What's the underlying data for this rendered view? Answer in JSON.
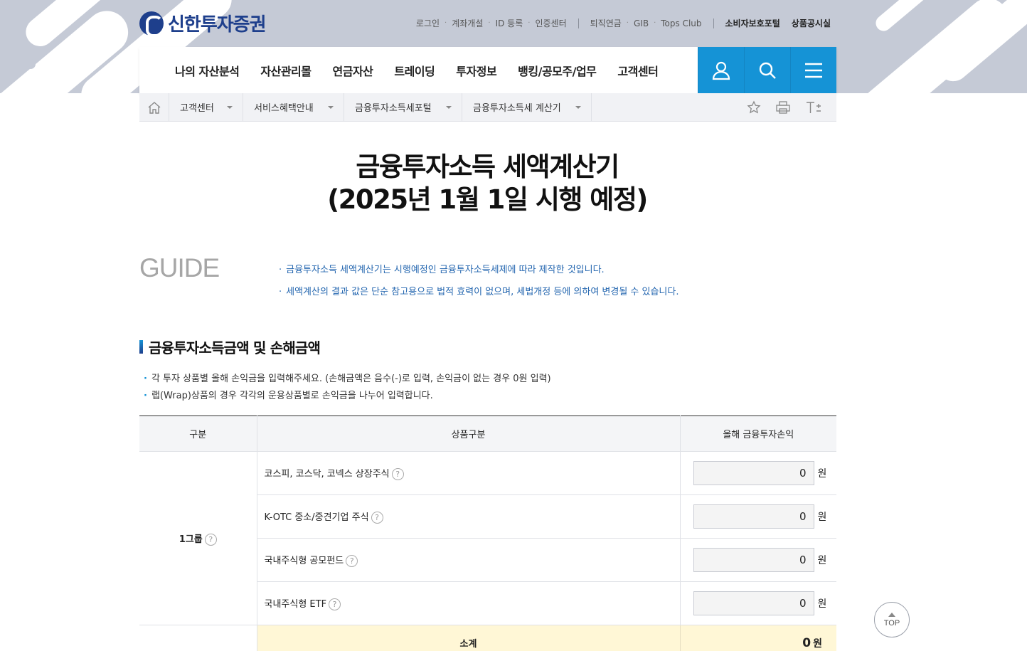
{
  "brand": {
    "name": "신한투자증권",
    "color": "#1e3f8c",
    "accent": "#1593d6"
  },
  "util_nav": {
    "group1": [
      "로그인",
      "계좌개설",
      "ID 등록",
      "인증센터"
    ],
    "group2": [
      "퇴직연금",
      "GIB",
      "Tops Club"
    ],
    "strong": [
      "소비자보호포털",
      "상품공시실"
    ]
  },
  "gnb": {
    "items": [
      "나의 자산분석",
      "자산관리몰",
      "연금자산",
      "트레이딩",
      "투자정보",
      "뱅킹/공모주/업무",
      "고객센터"
    ],
    "buttons": [
      "user-icon",
      "search-icon",
      "menu-icon"
    ]
  },
  "breadcrumb": {
    "items": [
      "고객센터",
      "서비스혜택안내",
      "금융투자소득세포털",
      "금융투자소득세 계산기"
    ],
    "tools": [
      "star-icon",
      "print-icon",
      "font-size-icon"
    ]
  },
  "page": {
    "title_line1": "금융투자소득 세액계산기",
    "title_line2": "(2025년 1월 1일 시행 예정)"
  },
  "guide": {
    "label": "GUIDE",
    "items": [
      "금융투자소득 세액계산기는 시행예정인 금융투자소득세제에 따라 제작한 것입니다.",
      "세액계산의 결과 값은 단순 참고용으로 법적 효력이 없으며, 세법개정 등에 의하여 변경될 수 있습니다."
    ]
  },
  "section": {
    "title": "금융투자소득금액 및 손해금액",
    "notes": [
      "각 투자 상품별 올해 손익금을 입력해주세요. (손해금액은 음수(-)로 입력, 손익금이 없는 경우 0원 입력)",
      "랩(Wrap)상품의 경우 각각의 운용상품별로 손익금을 나누어 입력합니다."
    ]
  },
  "table": {
    "headers": [
      "구분",
      "상품구분",
      "올해 금융투자손익"
    ],
    "group_label": "1그룹",
    "help": "?",
    "unit": "원",
    "rows": [
      {
        "product": "코스피, 코스닥, 코넥스 상장주식",
        "value": "0"
      },
      {
        "product": "K-OTC 중소/중견기업 주식",
        "value": "0"
      },
      {
        "product": "국내주식형 공모펀드",
        "value": "0"
      },
      {
        "product": "국내주식형 ETF",
        "value": "0"
      }
    ],
    "subtotal_label": "소계",
    "subtotal_value": "0"
  },
  "top_button": "TOP"
}
